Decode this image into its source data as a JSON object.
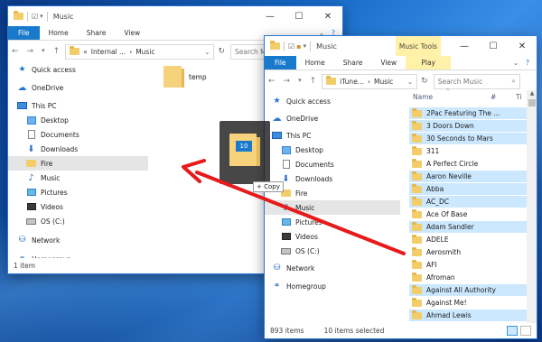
{
  "left_window": {
    "title": "Music",
    "tabs": [
      "File",
      "Home",
      "Share",
      "View"
    ],
    "address": {
      "overflow": "«",
      "path": [
        "Internal ...",
        "Music"
      ]
    },
    "search_placeholder": "Search Music",
    "nav": [
      {
        "label": "Quick access",
        "icon": "star-icon"
      },
      {
        "label": "OneDrive",
        "icon": "cloud-icon"
      },
      {
        "label": "This PC",
        "icon": "computer-icon"
      },
      {
        "label": "Desktop",
        "icon": "desktop-icon"
      },
      {
        "label": "Documents",
        "icon": "documents-icon"
      },
      {
        "label": "Downloads",
        "icon": "download-icon"
      },
      {
        "label": "Fire",
        "icon": "folder-icon",
        "state": "drop-target"
      },
      {
        "label": "Music",
        "icon": "music-icon"
      },
      {
        "label": "Pictures",
        "icon": "pictures-icon"
      },
      {
        "label": "Videos",
        "icon": "videos-icon"
      },
      {
        "label": "OS (C:)",
        "icon": "drive-icon"
      },
      {
        "label": "Network",
        "icon": "network-icon"
      },
      {
        "label": "Homegroup",
        "icon": "homegroup-icon"
      }
    ],
    "files": [
      {
        "name": "temp"
      }
    ],
    "status": "1 item"
  },
  "right_window": {
    "title": "Music",
    "context_tab_group": "Music Tools",
    "tabs": [
      "File",
      "Home",
      "Share",
      "View",
      "Play"
    ],
    "address": {
      "path": [
        "iTune...",
        "Music"
      ]
    },
    "search_placeholder": "Search Music",
    "columns": [
      "Name",
      "#",
      "Ti"
    ],
    "nav": [
      {
        "label": "Quick access",
        "icon": "star-icon"
      },
      {
        "label": "OneDrive",
        "icon": "cloud-icon"
      },
      {
        "label": "This PC",
        "icon": "computer-icon"
      },
      {
        "label": "Desktop",
        "icon": "desktop-icon"
      },
      {
        "label": "Documents",
        "icon": "documents-icon"
      },
      {
        "label": "Downloads",
        "icon": "download-icon"
      },
      {
        "label": "Fire",
        "icon": "folder-icon"
      },
      {
        "label": "Music",
        "icon": "music-icon",
        "state": "selected"
      },
      {
        "label": "Pictures",
        "icon": "pictures-icon"
      },
      {
        "label": "Videos",
        "icon": "videos-icon"
      },
      {
        "label": "OS (C:)",
        "icon": "drive-icon"
      },
      {
        "label": "Network",
        "icon": "network-icon"
      },
      {
        "label": "Homegroup",
        "icon": "homegroup-icon"
      }
    ],
    "files": [
      {
        "name": "2Pac Featuring The ...",
        "selected": true
      },
      {
        "name": "3 Doors Down",
        "selected": true
      },
      {
        "name": "30 Seconds to Mars",
        "selected": true
      },
      {
        "name": "311",
        "selected": false
      },
      {
        "name": "A Perfect Circle",
        "selected": false
      },
      {
        "name": "Aaron Neville",
        "selected": true
      },
      {
        "name": "Abba",
        "selected": true
      },
      {
        "name": "AC_DC",
        "selected": true
      },
      {
        "name": "Ace Of Base",
        "selected": false
      },
      {
        "name": "Adam Sandler",
        "selected": true
      },
      {
        "name": "ADELE",
        "selected": false
      },
      {
        "name": "Aerosmith",
        "selected": false
      },
      {
        "name": "AFI",
        "selected": false
      },
      {
        "name": "Afroman",
        "selected": false
      },
      {
        "name": "Against All Authority",
        "selected": true
      },
      {
        "name": "Against Me!",
        "selected": false
      },
      {
        "name": "Ahmad Lewis",
        "selected": true
      }
    ],
    "status_items": "893 items",
    "status_selected": "10 items selected"
  },
  "drag": {
    "count_badge": "10",
    "tooltip": "+ Copy"
  },
  "colors": {
    "accent": "#1979ca",
    "selection": "#cce8ff",
    "arrow": "#e8191a",
    "context_tab": "#fff2a8"
  }
}
